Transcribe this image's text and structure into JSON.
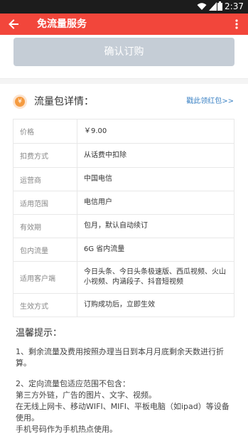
{
  "status_bar": {
    "time": "2:37"
  },
  "app_bar": {
    "title": "免流量服务"
  },
  "confirm_button": "确认订购",
  "details": {
    "title": "流量包详情：",
    "coupon_link": "戳此领红包>>",
    "rows": [
      {
        "key": "价格",
        "value": "￥9.00"
      },
      {
        "key": "扣费方式",
        "value": "从话费中扣除"
      },
      {
        "key": "运营商",
        "value": "中国电信"
      },
      {
        "key": "适用范围",
        "value": "电信用户"
      },
      {
        "key": "有效期",
        "value": "包月，默认自动续订"
      },
      {
        "key": "包内流量",
        "value": "6G 省内流量"
      },
      {
        "key": "适用客户端",
        "value": "今日头条、今日头条极速版、西瓜视频、火山小视频、内涵段子、抖音短视频"
      },
      {
        "key": "生效方式",
        "value": "订购成功后，立即生效"
      }
    ]
  },
  "tips": {
    "title": "温馨提示：",
    "p1": "1、剩余流量及费用按照办理当日到本月月底剩余天数进行折算。",
    "p2_l1": "2、定向流量包适应范围不包含：",
    "p2_l2": "第三方外链，广告的图片、文字、视频。",
    "p2_l3": "在无线上网卡、移动WIFI、MIFI、平板电脑（如ipad）等设备使用。",
    "p2_l4": "手机号码作为手机热点使用。"
  },
  "colors": {
    "app_bar": "#f2463b",
    "button_disabled": "#c5cdd6",
    "link": "#3b82c4"
  }
}
